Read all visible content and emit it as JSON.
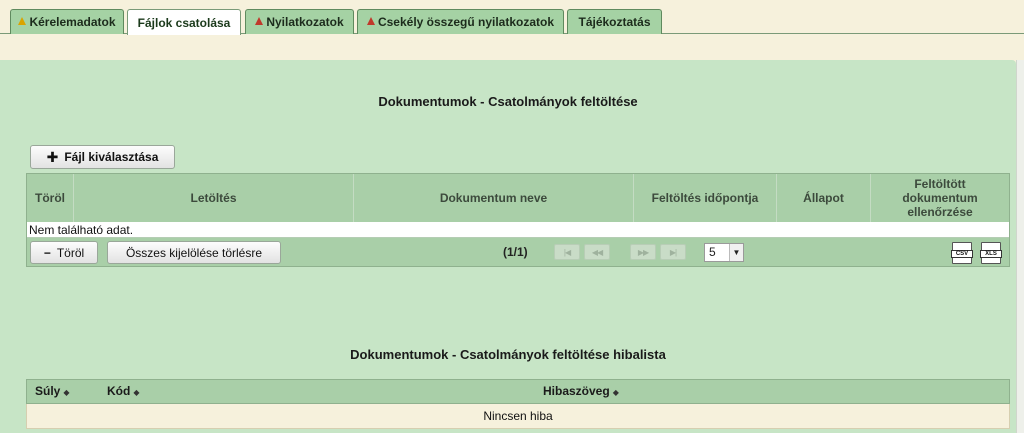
{
  "tabs": [
    {
      "label": "Kérelemadatok",
      "icon": "warning-yellow"
    },
    {
      "label": "Fájlok csatolása",
      "icon": "",
      "active": true
    },
    {
      "label": "Nyilatkozatok",
      "icon": "warning-red"
    },
    {
      "label": "Csekély összegű nyilatkozatok",
      "icon": "warning-red"
    },
    {
      "label": "Tájékoztatás",
      "icon": ""
    }
  ],
  "upload": {
    "title": "Dokumentumok - Csatolmányok feltöltése",
    "choose_file_label": "Fájl kiválasztása",
    "columns": [
      "Töröl",
      "Letöltés",
      "Dokumentum neve",
      "Feltöltés időpontja",
      "Állapot",
      "Feltöltött dokumentum ellenőrzése"
    ],
    "empty_text": "Nem található adat.",
    "delete_label": "Töröl",
    "clear_selection_label": "Összes kijelölése törlésre",
    "page_info": "(1/1)",
    "rows_per_page": "5",
    "export_csv": "CSV",
    "export_xls": "XLS"
  },
  "errors": {
    "title": "Dokumentumok - Csatolmányok feltöltése hibalista",
    "columns": [
      "Súly",
      "Kód",
      "Hibaszöveg"
    ],
    "sort_glyph": "◆",
    "empty_text": "Nincsen hiba"
  },
  "colors": {
    "panel": "#c7e5c6",
    "header": "#a9cfa8",
    "page_bg": "#f6f1dc",
    "warning_yellow": "#d9a400",
    "warning_red": "#c0392b"
  }
}
